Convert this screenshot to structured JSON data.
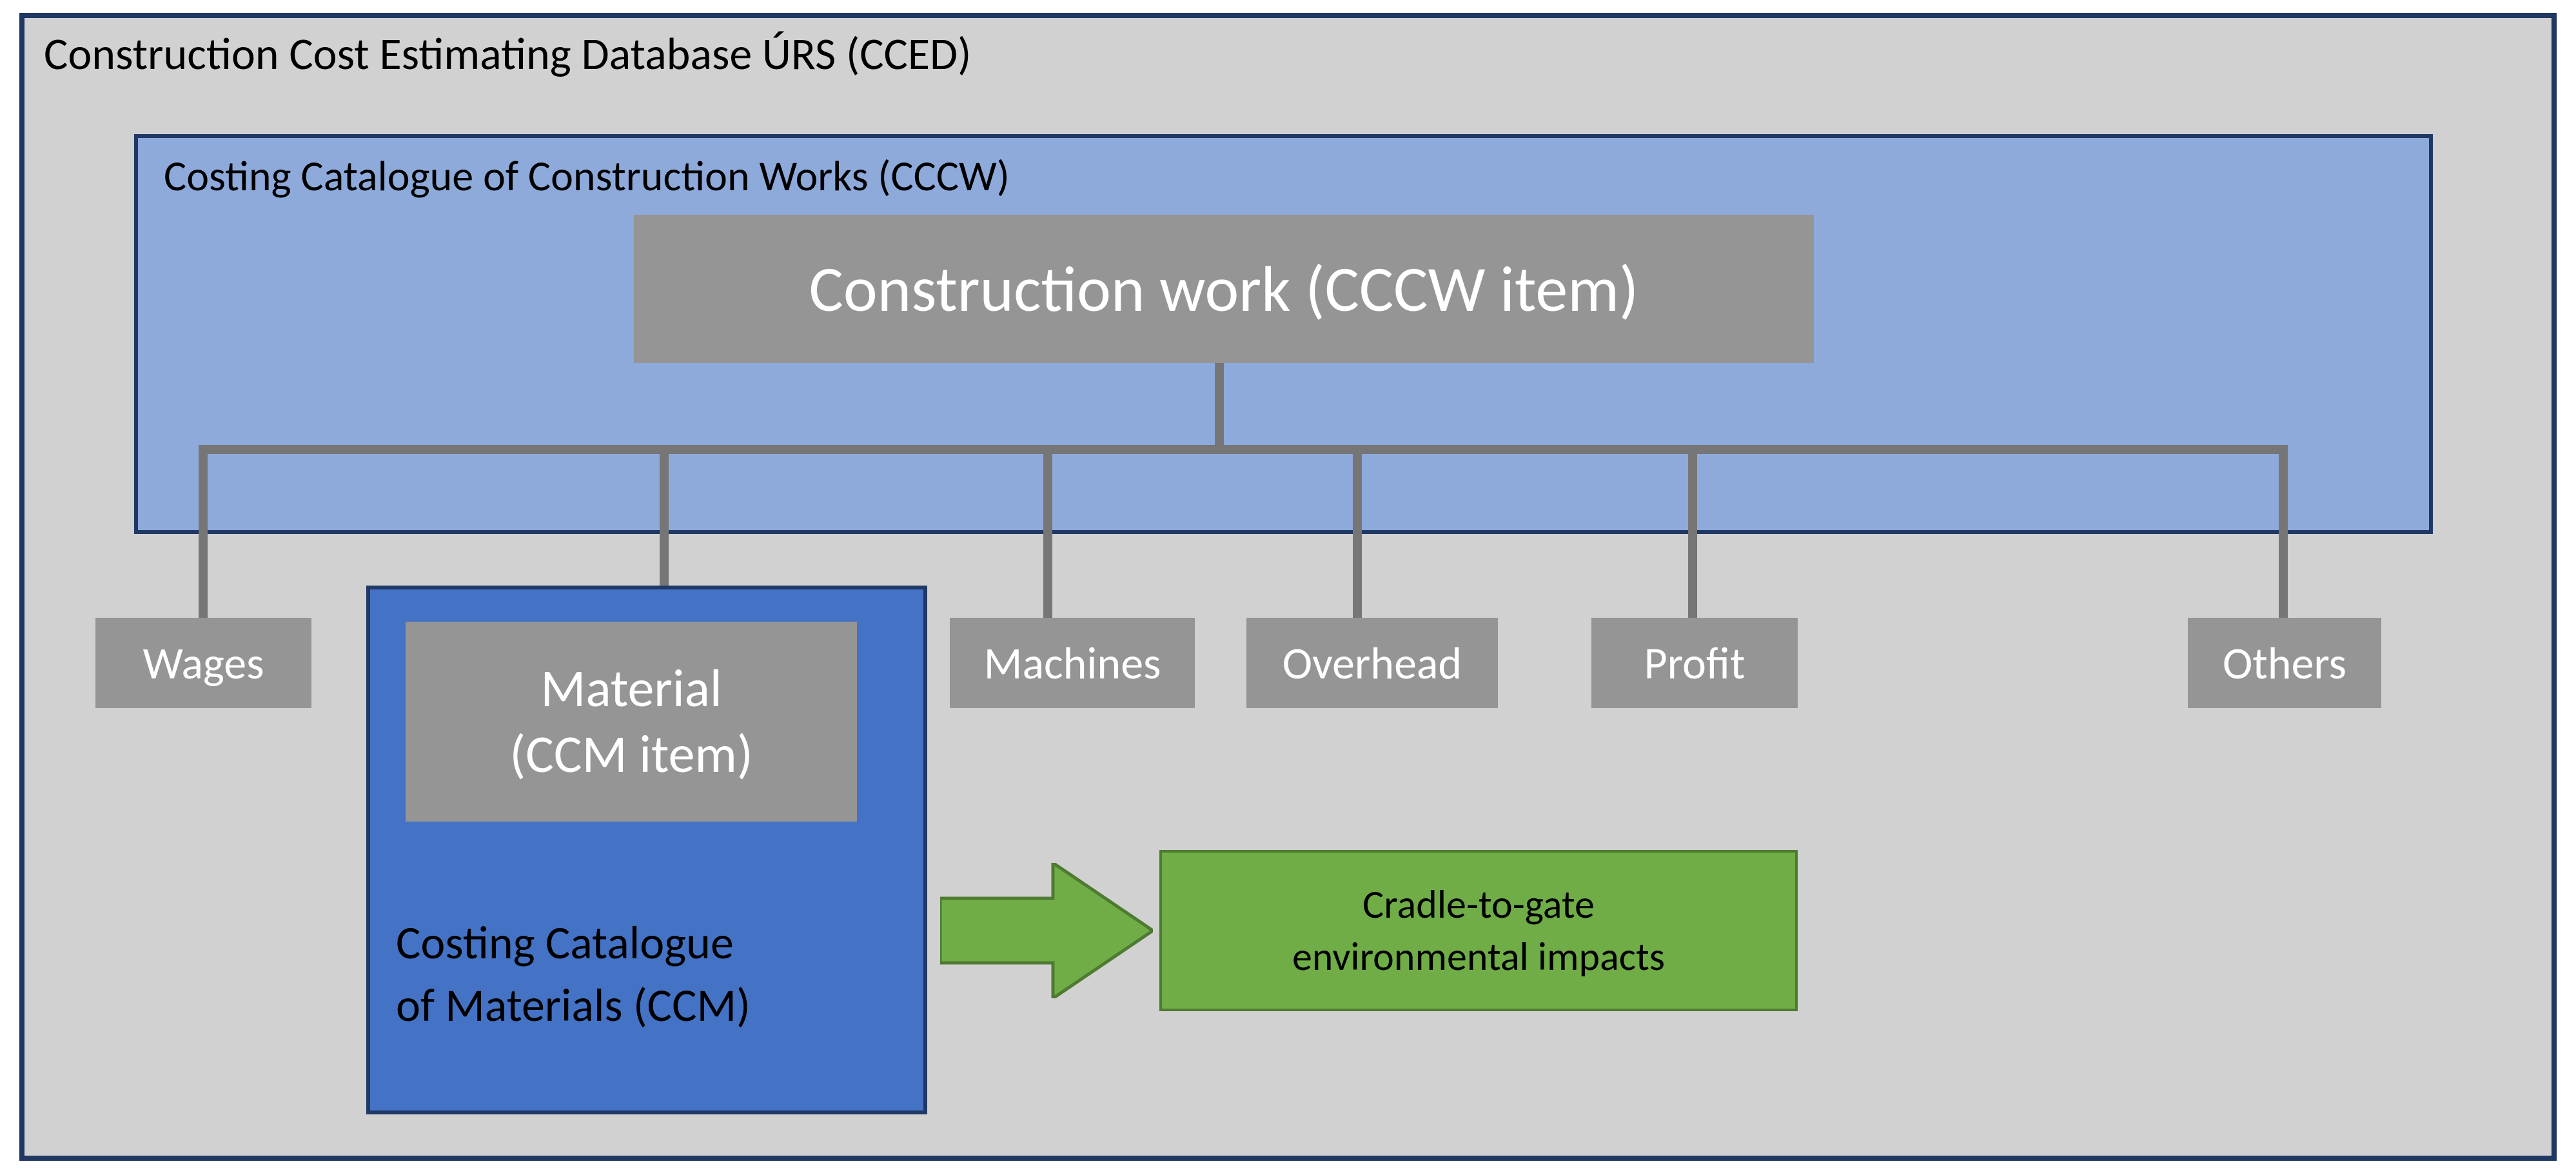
{
  "cced": {
    "title": "Construction Cost Estimating Database ÚRS (CCED)"
  },
  "cccw": {
    "title": "Costing Catalogue of Construction Works (CCCW)",
    "item_label": "Construction work (CCCW item)"
  },
  "branches": {
    "wages": "Wages",
    "machines": "Machines",
    "overhead": "Overhead",
    "profit": "Profit",
    "others": "Others"
  },
  "ccm": {
    "material_line1": "Material",
    "material_line2": "(CCM item)",
    "caption_line1": "Costing Catalogue",
    "caption_line2": "of Materials (CCM)"
  },
  "impacts": {
    "line1": "Cradle-to-gate",
    "line2": "environmental impacts"
  },
  "colors": {
    "outer_bg": "#d1d1d1",
    "outer_border": "#203864",
    "cccw_bg": "#8eaadb",
    "node_bg": "#959595",
    "ccm_bg": "#4472c4",
    "impacts_bg": "#70ad47",
    "arrow_fill": "#70ad47",
    "connector": "#767676"
  }
}
